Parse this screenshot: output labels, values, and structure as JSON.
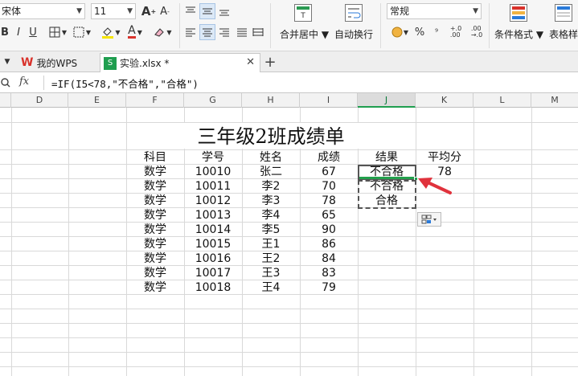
{
  "ribbon": {
    "font_name": "宋体",
    "font_size": "11",
    "merge_center_label": "合并居中",
    "wrap_text_label": "自动换行",
    "number_format": "常规",
    "percent_symbol": "%",
    "comma_symbol": "⁹",
    "inc_decimal": "+.0\n.00",
    "dec_decimal": ".00\n→.0",
    "cond_format_label": "条件格式",
    "table_style_label": "表格样",
    "bold": "B",
    "italic": "I",
    "underline": "U",
    "font_color_letter": "A",
    "accent_color": "#d9322b",
    "highlight_color": "#f5e400"
  },
  "tabs": [
    {
      "label": "我的WPS",
      "active": false
    },
    {
      "label": "实验.xlsx *",
      "active": true
    }
  ],
  "formula_bar": {
    "fx_label": "fx",
    "formula": "=IF(I5<78,\"不合格\",\"合格\")"
  },
  "columns": [
    "D",
    "E",
    "F",
    "G",
    "H",
    "I",
    "J",
    "K",
    "L",
    "M"
  ],
  "active_column": "J",
  "sheet": {
    "title": "三年级2班成绩单",
    "headers": [
      "科目",
      "学号",
      "姓名",
      "成绩",
      "结果",
      "平均分"
    ],
    "rows": [
      {
        "subject": "数学",
        "id": "10010",
        "name": "张二",
        "score": "67",
        "result": "不合格",
        "avg": "78"
      },
      {
        "subject": "数学",
        "id": "10011",
        "name": "李2",
        "score": "70",
        "result": "不合格",
        "avg": ""
      },
      {
        "subject": "数学",
        "id": "10012",
        "name": "李3",
        "score": "78",
        "result": "合格",
        "avg": ""
      },
      {
        "subject": "数学",
        "id": "10013",
        "name": "李4",
        "score": "65",
        "result": "",
        "avg": ""
      },
      {
        "subject": "数学",
        "id": "10014",
        "name": "李5",
        "score": "90",
        "result": "",
        "avg": ""
      },
      {
        "subject": "数学",
        "id": "10015",
        "name": "王1",
        "score": "86",
        "result": "",
        "avg": ""
      },
      {
        "subject": "数学",
        "id": "10016",
        "name": "王2",
        "score": "84",
        "result": "",
        "avg": ""
      },
      {
        "subject": "数学",
        "id": "10017",
        "name": "王3",
        "score": "83",
        "result": "",
        "avg": ""
      },
      {
        "subject": "数学",
        "id": "10018",
        "name": "王4",
        "score": "79",
        "result": "",
        "avg": ""
      }
    ]
  },
  "colors": {
    "select_green": "#1f9e4f",
    "arrow_red": "#e0323c"
  }
}
